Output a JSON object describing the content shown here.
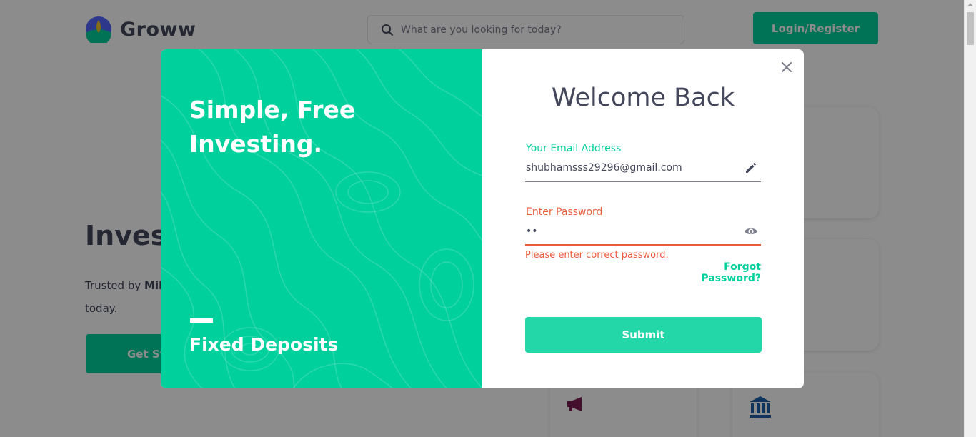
{
  "header": {
    "brand_name": "Groww",
    "search_placeholder": "What are you looking for today?",
    "login_label": "Login/Register"
  },
  "hero": {
    "title_partial": "Invest",
    "subtitle_prefix": "Trusted by ",
    "subtitle_bold_partial": "Mil",
    "subtitle_line2": "today.",
    "cta_partial": "Get St"
  },
  "modal": {
    "left": {
      "headline_line1": "Simple, Free",
      "headline_line2": "Investing.",
      "caption": "Fixed Deposits"
    },
    "right": {
      "title": "Welcome Back",
      "email_label": "Your Email Address",
      "email_value": "shubhamsss29296@gmail.com",
      "password_label": "Enter Password",
      "password_value": "••",
      "error_message": "Please enter correct password.",
      "forgot_label": "Forgot Password?",
      "submit_label": "Submit"
    }
  },
  "icons": {
    "search": "search-icon",
    "close": "close-icon",
    "edit": "pencil-icon",
    "visibility": "eye-icon",
    "megaphone": "megaphone-icon",
    "bank": "bank-icon"
  },
  "colors": {
    "brand_green": "#00d09c",
    "submit_green": "#24d7a9",
    "error_red": "#eb5b3c",
    "text_dark": "#44475b",
    "megaphone_purple": "#7b1d52",
    "bank_blue": "#1f5fa8"
  }
}
